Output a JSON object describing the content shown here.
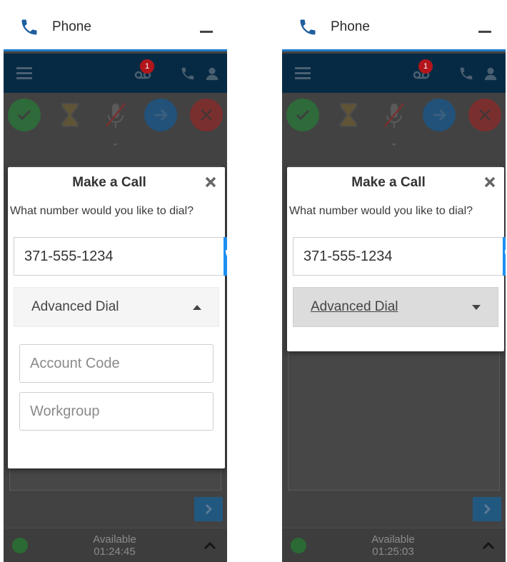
{
  "panels": [
    {
      "title": "Phone",
      "voicemail_badge": "1",
      "dialog": {
        "title": "Make a Call",
        "prompt": "What number would you like to dial?",
        "number_value": "371-555-1234",
        "advanced_label": "Advanced Dial",
        "advanced_expanded": true,
        "account_code_placeholder": "Account Code",
        "workgroup_placeholder": "Workgroup"
      },
      "status": {
        "label": "Available",
        "time": "01:24:45"
      }
    },
    {
      "title": "Phone",
      "voicemail_badge": "1",
      "dialog": {
        "title": "Make a Call",
        "prompt": "What number would you like to dial?",
        "number_value": "371-555-1234",
        "advanced_label": "Advanced Dial",
        "advanced_expanded": false
      },
      "status": {
        "label": "Available",
        "time": "01:25:03"
      }
    }
  ],
  "colors": {
    "accent_blue": "#1d8ff0",
    "nav_dark": "#072a44",
    "badge_red": "#b2161b",
    "overlay_gray": "#424242"
  },
  "icons": [
    "phone-icon",
    "minimize-icon",
    "menu-icon",
    "voicemail-icon",
    "user-icon",
    "check-icon",
    "hourglass-icon",
    "mute-icon",
    "transfer-icon",
    "hangup-icon",
    "close-icon",
    "chevron-down-icon",
    "chevron-right-icon",
    "chevron-up-icon",
    "available-icon"
  ]
}
